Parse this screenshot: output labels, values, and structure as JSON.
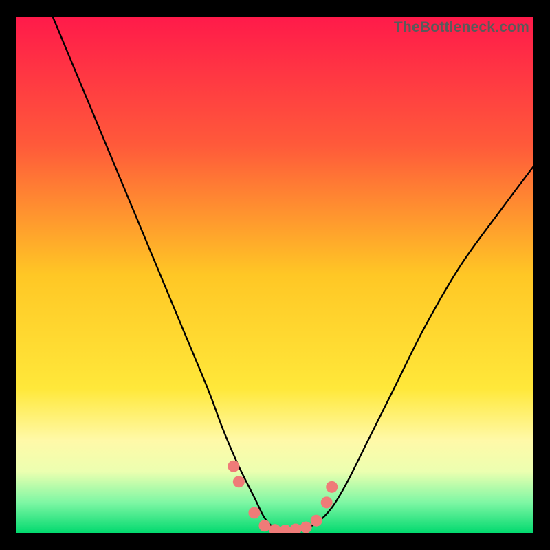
{
  "watermark": "TheBottleneck.com",
  "chart_data": {
    "type": "line",
    "title": "",
    "xlabel": "",
    "ylabel": "",
    "xlim": [
      0,
      100
    ],
    "ylim": [
      0,
      100
    ],
    "background_gradient": {
      "stops": [
        {
          "offset": 0,
          "color": "#ff1a4a"
        },
        {
          "offset": 25,
          "color": "#ff5a3a"
        },
        {
          "offset": 50,
          "color": "#ffc725"
        },
        {
          "offset": 72,
          "color": "#ffe83a"
        },
        {
          "offset": 82,
          "color": "#fff9a8"
        },
        {
          "offset": 88,
          "color": "#ecffb0"
        },
        {
          "offset": 94,
          "color": "#7ef7a4"
        },
        {
          "offset": 100,
          "color": "#00d96e"
        }
      ]
    },
    "series": [
      {
        "name": "curve",
        "color": "#000000",
        "x": [
          7,
          12,
          17,
          22,
          27,
          32,
          37,
          40,
          43,
          46,
          48,
          50,
          52,
          55,
          58,
          61,
          64,
          68,
          73,
          79,
          86,
          94,
          100
        ],
        "y": [
          100,
          88,
          76,
          64,
          52,
          40,
          28,
          20,
          13,
          7,
          3,
          1,
          0.5,
          0.8,
          2,
          5,
          10,
          18,
          28,
          40,
          52,
          63,
          71
        ]
      }
    ],
    "markers": {
      "color": "#ef7b78",
      "points": [
        {
          "x": 42,
          "y": 13
        },
        {
          "x": 43,
          "y": 10
        },
        {
          "x": 46,
          "y": 4
        },
        {
          "x": 48,
          "y": 1.5
        },
        {
          "x": 50,
          "y": 0.7
        },
        {
          "x": 52,
          "y": 0.6
        },
        {
          "x": 54,
          "y": 0.8
        },
        {
          "x": 56,
          "y": 1.2
        },
        {
          "x": 58,
          "y": 2.5
        },
        {
          "x": 60,
          "y": 6
        },
        {
          "x": 61,
          "y": 9
        }
      ]
    }
  }
}
